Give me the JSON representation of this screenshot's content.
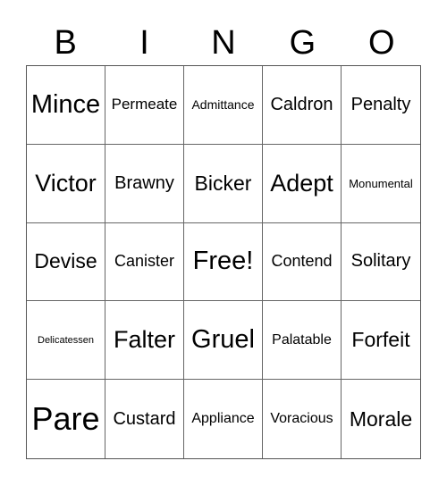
{
  "header": {
    "letters": [
      "B",
      "I",
      "N",
      "G",
      "O"
    ]
  },
  "board": {
    "rows": [
      [
        "Mince",
        "Permeate",
        "Admittance",
        "Caldron",
        "Penalty"
      ],
      [
        "Victor",
        "Brawny",
        "Bicker",
        "Adept",
        "Monumental"
      ],
      [
        "Devise",
        "Canister",
        "Free!",
        "Contend",
        "Solitary"
      ],
      [
        "Delicatessen",
        "Falter",
        "Gruel",
        "Palatable",
        "Forfeit"
      ],
      [
        "Pare",
        "Custard",
        "Appliance",
        "Voracious",
        "Morale"
      ]
    ]
  }
}
